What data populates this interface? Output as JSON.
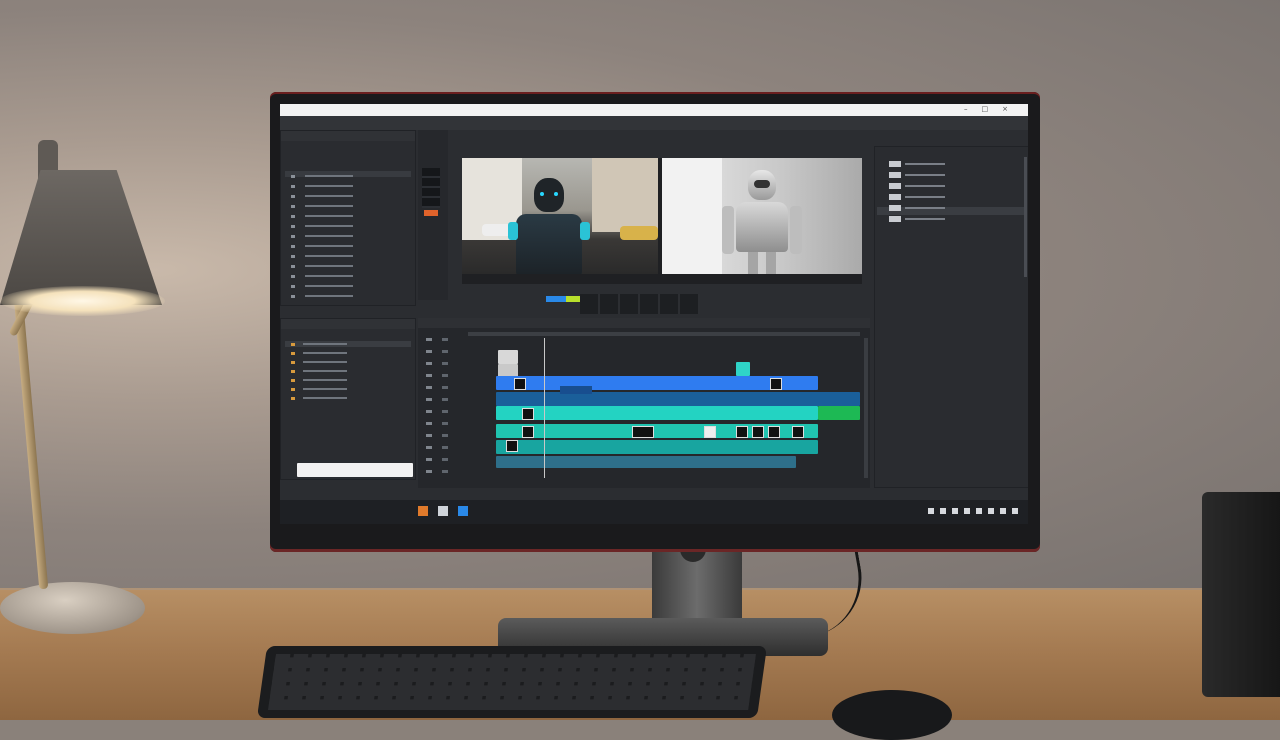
{
  "scene": {
    "wall_color": "#8d837d",
    "desk_color": "#a57b52",
    "lamp_light_color": "#fff7e6"
  },
  "screen": {
    "app": {
      "timeline_colors": {
        "blue": "#2f7cf0",
        "cyan": "#23d3c2",
        "green": "#1db954",
        "teal": "#1aa5a0"
      },
      "icons": [
        "close-icon",
        "minimize-icon",
        "maximize-icon",
        "folder-icon",
        "play-icon",
        "scissors-icon"
      ]
    }
  }
}
